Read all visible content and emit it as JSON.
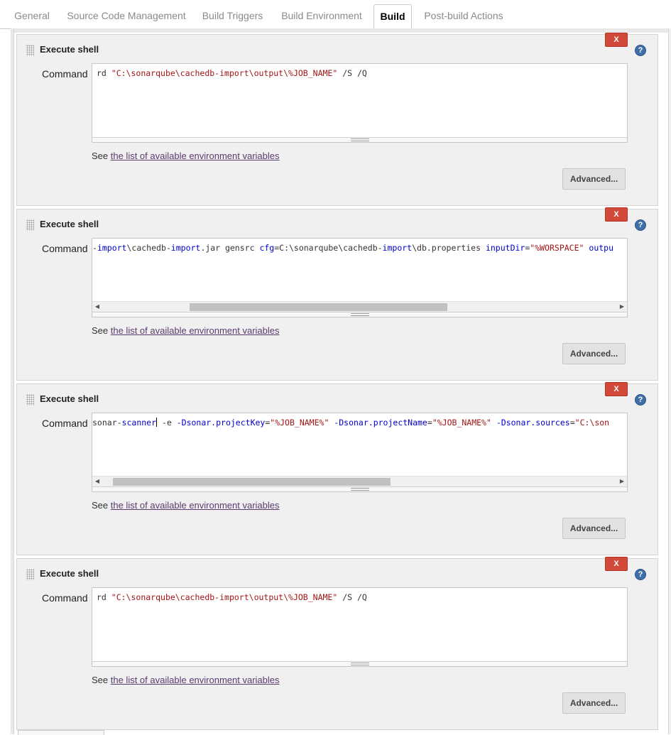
{
  "tabs": [
    "General",
    "Source Code Management",
    "Build Triggers",
    "Build Environment",
    "Build",
    "Post-build Actions"
  ],
  "active_tab": "Build",
  "steps": [
    {
      "title": "Execute shell",
      "delete_label": "X",
      "help_label": "?",
      "command_label": "Command",
      "command_segments": [
        {
          "t": "rd ",
          "c": ""
        },
        {
          "t": "\"C:\\sonarqube\\cachedb-import\\output\\%JOB_NAME\"",
          "c": "str"
        },
        {
          "t": " /S /Q",
          "c": ""
        }
      ],
      "has_hscroll": false,
      "see_prefix": "See ",
      "see_link": "the list of available environment variables",
      "advanced_label": "Advanced..."
    },
    {
      "title": "Execute shell",
      "delete_label": "X",
      "help_label": "?",
      "command_label": "Command",
      "command_segments": [
        {
          "t": "-",
          "c": ""
        },
        {
          "t": "import",
          "c": "kw"
        },
        {
          "t": "\\cachedb-",
          "c": ""
        },
        {
          "t": "import",
          "c": "kw"
        },
        {
          "t": ".jar gensrc ",
          "c": ""
        },
        {
          "t": "cfg",
          "c": "kw"
        },
        {
          "t": "=C:\\sonarqube\\cachedb-",
          "c": ""
        },
        {
          "t": "import",
          "c": "kw"
        },
        {
          "t": "\\db.properties ",
          "c": ""
        },
        {
          "t": "inputDir",
          "c": "kw"
        },
        {
          "t": "=",
          "c": ""
        },
        {
          "t": "\"%WORSPACE\"",
          "c": "str"
        },
        {
          "t": " ",
          "c": ""
        },
        {
          "t": "outpu",
          "c": "kw"
        }
      ],
      "has_hscroll": true,
      "scroll_thumb_fraction": [
        0.17,
        0.67
      ],
      "see_prefix": "See ",
      "see_link": "the list of available environment variables",
      "advanced_label": "Advanced..."
    },
    {
      "title": "Execute shell",
      "delete_label": "X",
      "help_label": "?",
      "command_label": "Command",
      "command_segments": [
        {
          "t": "sonar-",
          "c": ""
        },
        {
          "t": "scanner",
          "c": "kw"
        },
        {
          "t": "|CARET|",
          "c": "caret"
        },
        {
          "t": " -e ",
          "c": ""
        },
        {
          "t": "-Dsonar.projectKey",
          "c": "kw"
        },
        {
          "t": "=",
          "c": ""
        },
        {
          "t": "\"%JOB_NAME%\"",
          "c": "str"
        },
        {
          "t": " ",
          "c": ""
        },
        {
          "t": "-Dsonar.projectName",
          "c": "kw"
        },
        {
          "t": "=",
          "c": ""
        },
        {
          "t": "\"%JOB_NAME%\"",
          "c": "str"
        },
        {
          "t": " ",
          "c": ""
        },
        {
          "t": "-Dsonar.sources",
          "c": "kw"
        },
        {
          "t": "=",
          "c": ""
        },
        {
          "t": "\"C:\\son",
          "c": "str"
        }
      ],
      "has_hscroll": true,
      "scroll_thumb_fraction": [
        0.02,
        0.56
      ],
      "see_prefix": "See ",
      "see_link": "the list of available environment variables",
      "advanced_label": "Advanced..."
    },
    {
      "title": "Execute shell",
      "delete_label": "X",
      "help_label": "?",
      "command_label": "Command",
      "command_segments": [
        {
          "t": "rd ",
          "c": ""
        },
        {
          "t": "\"C:\\sonarqube\\cachedb-import\\output\\%JOB_NAME\"",
          "c": "str"
        },
        {
          "t": " /S /Q",
          "c": ""
        }
      ],
      "has_hscroll": false,
      "see_prefix": "See ",
      "see_link": "the list of available environment variables",
      "advanced_label": "Advanced..."
    }
  ]
}
